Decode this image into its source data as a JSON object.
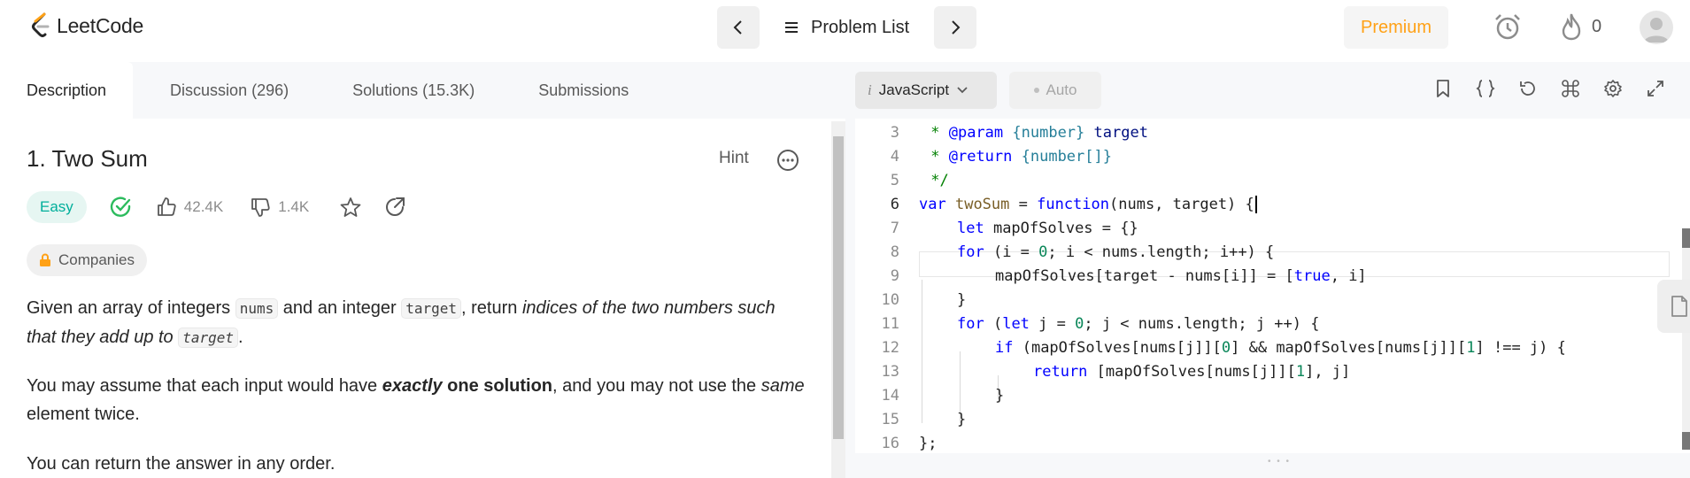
{
  "topnav": {
    "logo_text": "LeetCode",
    "problem_list_label": "Problem List",
    "premium_label": "Premium",
    "streak_count": "0"
  },
  "left_tabs": [
    {
      "label": "Description",
      "active": true
    },
    {
      "label": "Discussion (296)",
      "active": false
    },
    {
      "label": "Solutions (15.3K)",
      "active": false
    },
    {
      "label": "Submissions",
      "active": false
    }
  ],
  "problem": {
    "title": "1. Two Sum",
    "hint_label": "Hint",
    "difficulty": "Easy",
    "likes": "42.4K",
    "dislikes": "1.4K",
    "companies_label": "Companies",
    "p1_a": "Given an array of integers ",
    "p1_code1": "nums",
    "p1_b": " and an integer ",
    "p1_code2": "target",
    "p1_c": ", return ",
    "p1_italic": "indices of the two numbers such that they add up to",
    "p1_space": " ",
    "p1_code3": "target",
    "p1_end": ".",
    "p2_a": "You may assume that each input would have ",
    "p2_bold_italic": "exactly",
    "p2_bold": " one solution",
    "p2_b": ", and you may not use the ",
    "p2_italic": "same",
    "p2_c": " element twice.",
    "p3": "You can return the answer in any order."
  },
  "editor": {
    "language": "JavaScript",
    "language_prefix": "i",
    "auto_label": "Auto",
    "line_numbers": [
      "3",
      "4",
      "5",
      "6",
      "7",
      "8",
      "9",
      "10",
      "11",
      "12",
      "13",
      "14",
      "15",
      "16"
    ],
    "code": {
      "l3_star": " * ",
      "l3_tag": "@param",
      "l3_type": "{number}",
      "l3_name": " target",
      "l4_star": " * ",
      "l4_tag": "@return",
      "l4_type": "{number[]}",
      "l5": " */",
      "l6_var": "var",
      "l6_name": "twoSum",
      "l6_eq": " = ",
      "l6_function": "function",
      "l6_params": "(nums, target) {",
      "l7_let": "let",
      "l7_rest": " mapOfSolves = {}",
      "l8_for": "for",
      "l8_a": " (i = ",
      "l8_zero": "0",
      "l8_b": "; i < nums.length; i++) {",
      "l9_a": "mapOfSolves[target - nums[i]] = [",
      "l9_true": "true",
      "l9_b": ", i]",
      "l10": "}",
      "l11_for": "for",
      "l11_a": " (",
      "l11_let": "let",
      "l11_b": " j = ",
      "l11_zero": "0",
      "l11_c": "; j < nums.length; j ++) {",
      "l12_if": "if",
      "l12_a": " (mapOfSolves[nums[j]][",
      "l12_zero": "0",
      "l12_b": "] && mapOfSolves[nums[j]][",
      "l12_one": "1",
      "l12_c": "] !== j) {",
      "l13_return": "return",
      "l13_a": " [mapOfSolves[nums[j]][",
      "l13_one": "1",
      "l13_b": "], j]",
      "l14": "}",
      "l15": "}",
      "l16": "};"
    }
  },
  "colors": {
    "accent_orange": "#ffa116",
    "easy_green": "#00af9b",
    "keyword_blue": "#0000ff",
    "comment_green": "#008000"
  }
}
